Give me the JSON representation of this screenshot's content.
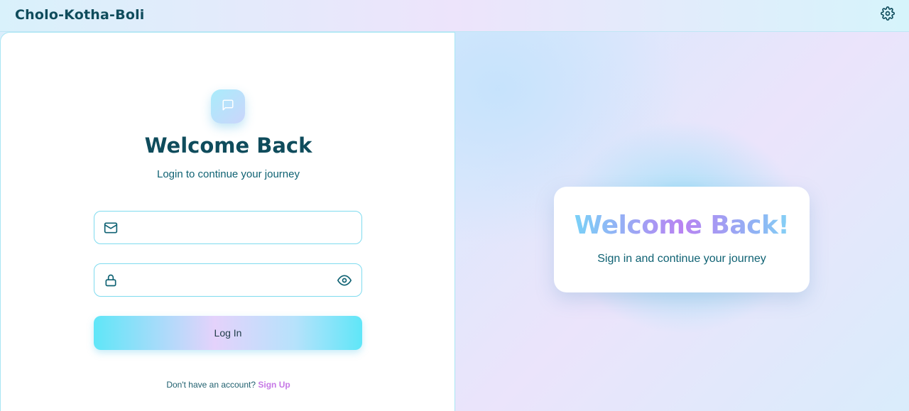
{
  "header": {
    "brand": "Cholo-Kotha-Boli",
    "settings_icon": "gear-icon"
  },
  "login": {
    "badge_icon": "chat-bubble-icon",
    "title": "Welcome Back",
    "subtitle": "Login to continue your journey",
    "email": {
      "value": "",
      "placeholder": "",
      "icon": "mail-icon"
    },
    "password": {
      "value": "",
      "placeholder": "",
      "icon": "lock-icon",
      "toggle_icon": "eye-icon"
    },
    "login_label": "Log In",
    "signup_prompt": "Don't have an account?",
    "signup_link": "Sign Up"
  },
  "promo": {
    "title": "Welcome Back!",
    "subtitle": "Sign in and continue your journey"
  },
  "colors": {
    "primary_text": "#0f4c5c",
    "accent_cyan": "#5fe6f8",
    "accent_purple": "#c678e6"
  }
}
